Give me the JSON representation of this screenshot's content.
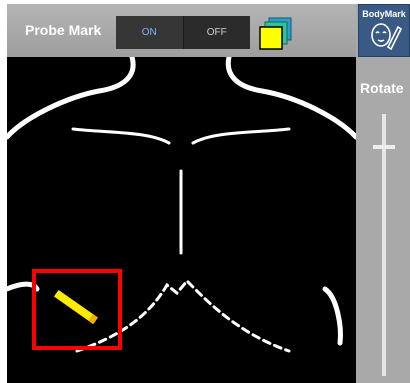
{
  "toolbar": {
    "title": "Probe Mark",
    "toggle": {
      "on_label": "ON",
      "off_label": "OFF",
      "selected": "ON"
    },
    "layers_icon": "stacked-layers-icon"
  },
  "sidepanel": {
    "bodymark_label": "BodyMark",
    "bodymark_icon": "head-pencil-icon",
    "rotate_label": "Rotate",
    "rotate_slider_value": 0.12
  },
  "canvas": {
    "probe_marker_color": "#ffeb00",
    "selection_highlight_color": "#ff0000"
  },
  "colors": {
    "accent_on": "#7ab4ff",
    "bodymark_bg": "#3a5a86",
    "panel_gray": "#a9a9a9"
  }
}
